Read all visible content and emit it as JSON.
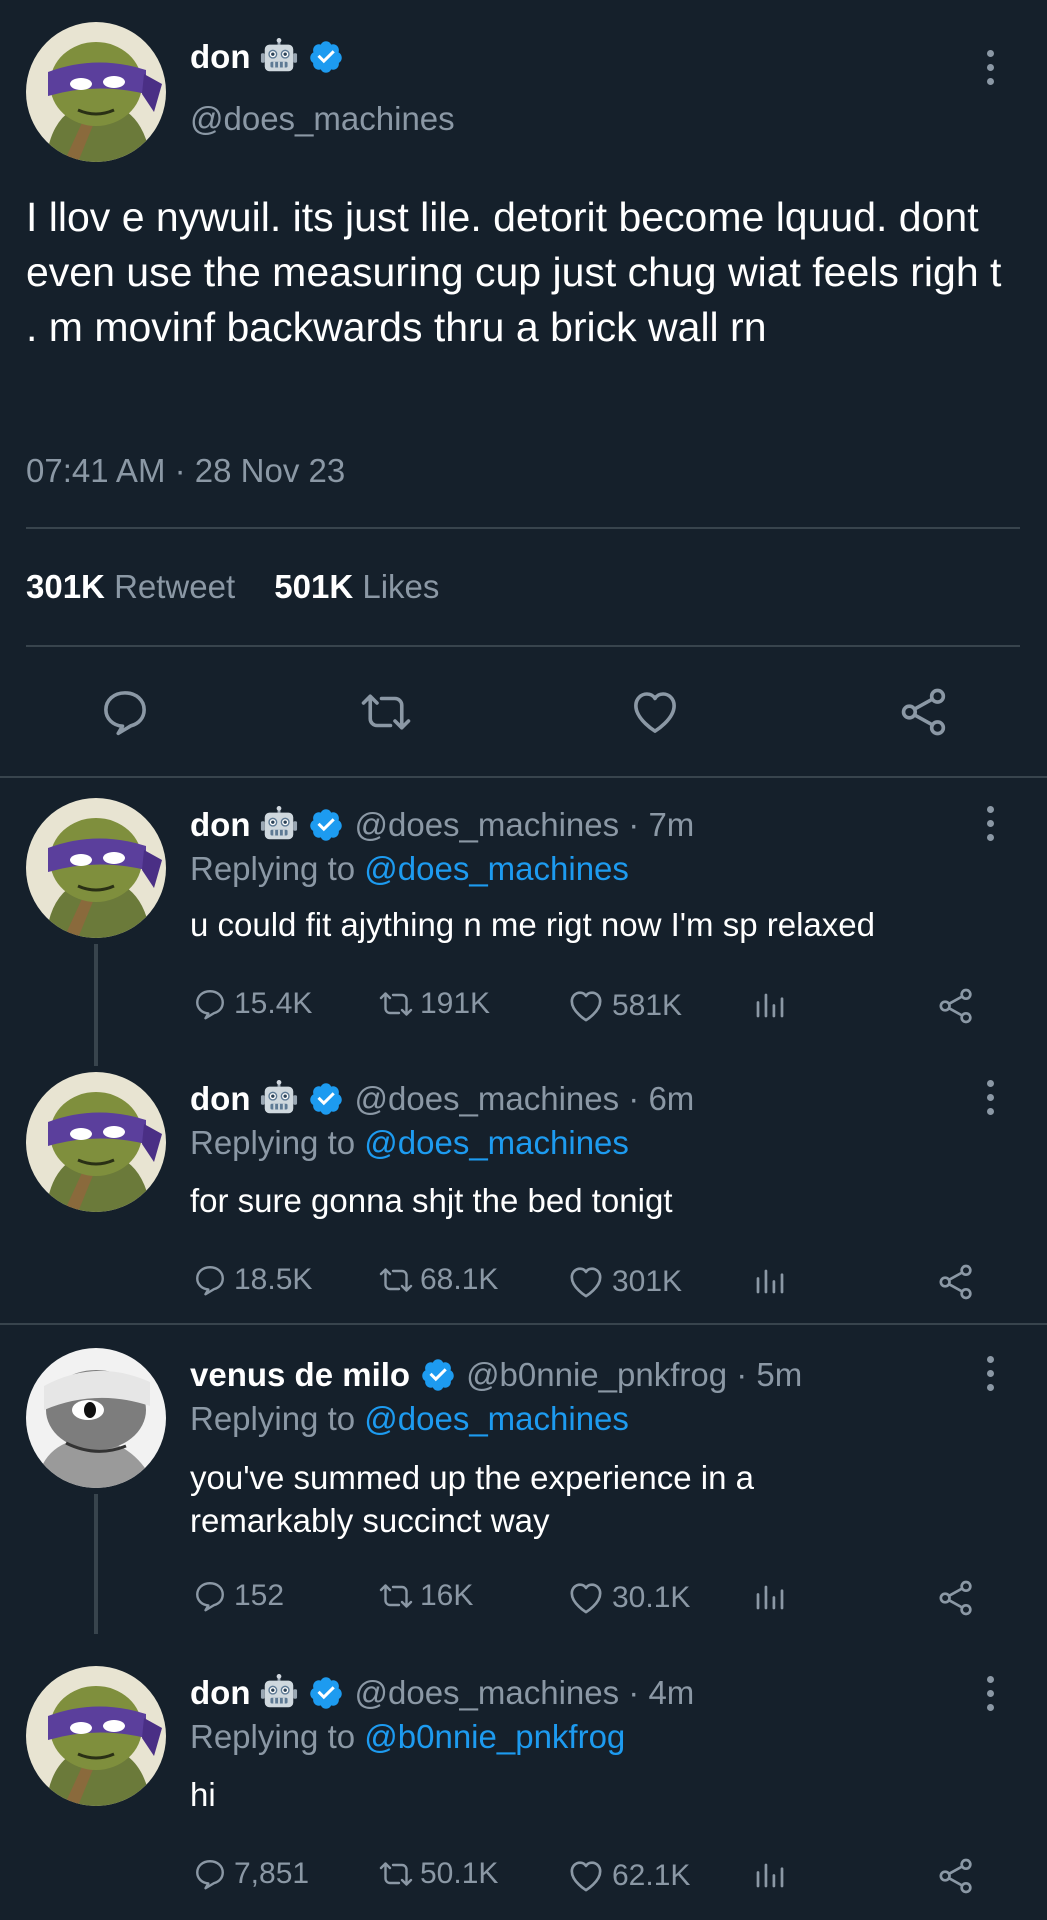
{
  "main_tweet": {
    "author_name": "don",
    "author_handle": "@does_machines",
    "text": "I llov e nywuil. its just lile. detorit become lquud. dont even use the measuring cup just chug wiat feels righ t . m movinf backwards thru a brick wall rn",
    "timestamp": "07:41 AM · 28 Nov 23",
    "retweets_count": "301K",
    "retweets_label": "Retweet",
    "likes_count": "501K",
    "likes_label": "Likes"
  },
  "replies": [
    {
      "author_name": "don",
      "author_handle": "@does_machines · 7m",
      "replying_prefix": "Replying to ",
      "replying_to": "@does_machines",
      "text": "u could fit ajything n me rigt now I'm sp relaxed",
      "replies": "15.4K",
      "retweets": "191K",
      "likes": "581K"
    },
    {
      "author_name": "don",
      "author_handle": "@does_machines · 6m",
      "replying_prefix": "Replying to ",
      "replying_to": "@does_machines",
      "text": "for sure gonna shjt the bed tonigt",
      "replies": "18.5K",
      "retweets": "68.1K",
      "likes": "301K"
    },
    {
      "author_name": "venus de milo",
      "author_handle": "@b0nnie_pnkfrog · 5m",
      "replying_prefix": "Replying to ",
      "replying_to": "@does_machines",
      "text": "you've summed up the experience in a remarkably succinct way",
      "replies": "152",
      "retweets": "16K",
      "likes": "30.1K"
    },
    {
      "author_name": "don",
      "author_handle": "@does_machines · 4m",
      "replying_prefix": "Replying to ",
      "replying_to": "@b0nnie_pnkfrog",
      "text": "hi",
      "replies": "7,851",
      "retweets": "50.1K",
      "likes": "62.1K"
    }
  ],
  "colors": {
    "background": "#15202b",
    "accent": "#1d9bf0",
    "muted": "#8b98a5",
    "divider": "#38444d"
  },
  "icons": {
    "robot": "robot-emoji-icon",
    "verified": "verified-badge-icon",
    "reply": "reply-icon",
    "retweet": "retweet-icon",
    "like": "heart-icon",
    "analytics": "analytics-icon",
    "share": "share-icon",
    "more": "more-options-icon"
  }
}
